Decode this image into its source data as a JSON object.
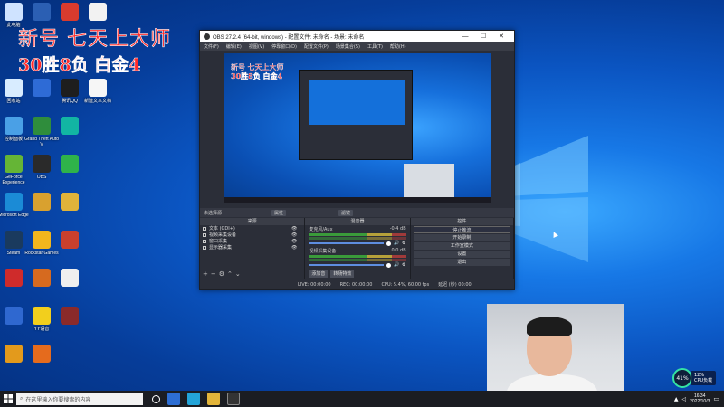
{
  "overlay": {
    "title": "新号 七天上大师",
    "record": "30胜8负 白金4"
  },
  "desktop_icons": [
    {
      "label": "此电脑",
      "color": "#cfe3ff",
      "col": 0,
      "row": 0
    },
    {
      "label": "",
      "color": "#2b5fb3",
      "col": 1,
      "row": 0
    },
    {
      "label": "",
      "color": "#d83b2e",
      "col": 2,
      "row": 0
    },
    {
      "label": "",
      "color": "#f2f2f2",
      "col": 3,
      "row": 0
    },
    {
      "label": "回收站",
      "color": "#d8ecff",
      "col": 0,
      "row": 2
    },
    {
      "label": "",
      "color": "#2e6bd6",
      "col": 1,
      "row": 2
    },
    {
      "label": "腾讯QQ",
      "color": "#1e1e1e",
      "col": 2,
      "row": 2
    },
    {
      "label": "新建文本文档",
      "color": "#f6f6f6",
      "col": 3,
      "row": 2
    },
    {
      "label": "控制面板",
      "color": "#4aa0e6",
      "col": 0,
      "row": 3
    },
    {
      "label": "Grand Theft Auto V",
      "color": "#2f8d3c",
      "col": 1,
      "row": 3
    },
    {
      "label": "",
      "color": "#12b5a3",
      "col": 2,
      "row": 3
    },
    {
      "label": "GeForce Experience",
      "color": "#65b536",
      "col": 0,
      "row": 4
    },
    {
      "label": "OBS",
      "color": "#2a2a2a",
      "col": 1,
      "row": 4
    },
    {
      "label": "",
      "color": "#2fb34a",
      "col": 2,
      "row": 4
    },
    {
      "label": "Microsoft Edge",
      "color": "#1b8bd6",
      "col": 0,
      "row": 5
    },
    {
      "label": "",
      "color": "#d9a12f",
      "col": 1,
      "row": 5
    },
    {
      "label": "",
      "color": "#e0b33a",
      "col": 2,
      "row": 5
    },
    {
      "label": "Steam",
      "color": "#1a3a5e",
      "col": 0,
      "row": 6
    },
    {
      "label": "Rockstar Games",
      "color": "#f2b61d",
      "col": 1,
      "row": 6
    },
    {
      "label": "",
      "color": "#c9402d",
      "col": 2,
      "row": 6
    },
    {
      "label": "",
      "color": "#cf2b2b",
      "col": 0,
      "row": 7
    },
    {
      "label": "",
      "color": "#d66a1f",
      "col": 1,
      "row": 7
    },
    {
      "label": "",
      "color": "#efefef",
      "col": 2,
      "row": 7
    },
    {
      "label": "",
      "color": "#2f68d0",
      "col": 0,
      "row": 8
    },
    {
      "label": "YY语音",
      "color": "#f2cf1d",
      "col": 1,
      "row": 8
    },
    {
      "label": "",
      "color": "#8a2a2a",
      "col": 2,
      "row": 8
    },
    {
      "label": "",
      "color": "#e39a1c",
      "col": 0,
      "row": 9
    },
    {
      "label": "",
      "color": "#e56b1d",
      "col": 1,
      "row": 9
    }
  ],
  "obs": {
    "title": "OBS 27.2.4 (64-bit, windows) - 配置文件: 未命名 - 场景: 未命名",
    "menu": [
      "文件(F)",
      "编辑(E)",
      "视图(V)",
      "停靠窗口(D)",
      "配置文件(P)",
      "场景集合(S)",
      "工具(T)",
      "帮助(H)"
    ],
    "scene_bar": {
      "label": "未选择源",
      "props": "属性",
      "filters": "滤镜"
    },
    "sources_header": "来源",
    "sources": [
      "文本 (GDI+)",
      "视频采集设备",
      "窗口采集",
      "显示器采集"
    ],
    "mixer_header": "混音器",
    "mixer": [
      {
        "name": "麦克风/Aux",
        "db": "-0.4 dB"
      },
      {
        "name": "视频采集设备",
        "db": "0.0 dB"
      }
    ],
    "mixer_buttons": [
      "添加音",
      "转场特效"
    ],
    "controls_header": "控件",
    "controls": [
      "停止推流",
      "开始录制",
      "工作室模式",
      "设置",
      "退出"
    ],
    "status": [
      "LIVE: 00:00:00",
      "REC: 00:00:00",
      "CPU: 5.4%, 60.00 fps",
      "延迟 (秒) 00:00"
    ]
  },
  "taskbar": {
    "search_placeholder": "在这里输入你要搜索的内容",
    "time": "16:34",
    "date": "2022/10/3"
  },
  "cpu_widget": {
    "percent": "41%",
    "line1": "12%",
    "line2": "CPU负载"
  }
}
